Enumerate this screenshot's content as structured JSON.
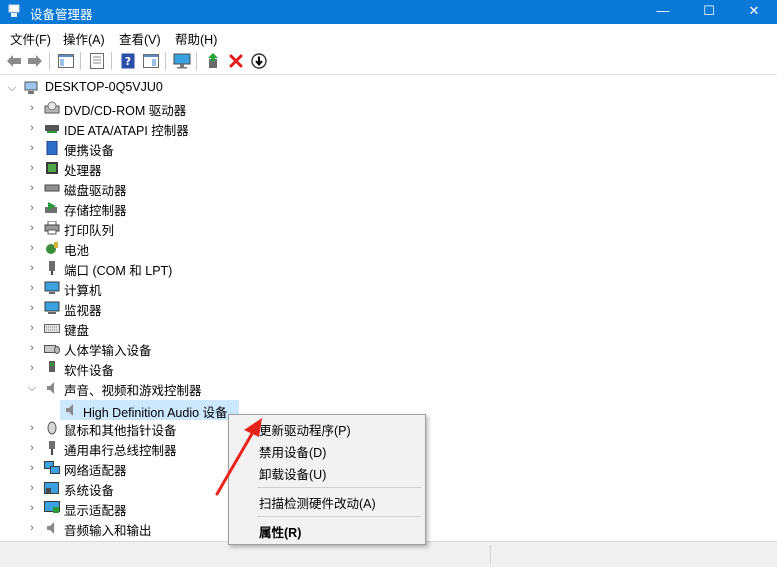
{
  "window": {
    "title": "设备管理器",
    "minimize_glyph": "—",
    "maximize_glyph": "☐",
    "close_glyph": "✕",
    "accent": "#0a78d7"
  },
  "menu": [
    "文件(F)",
    "操作(A)",
    "查看(V)",
    "帮助(H)"
  ],
  "toolbar": {
    "icons": [
      "back-arrow-icon",
      "forward-arrow-icon",
      "console-tree-icon",
      "properties-icon",
      "help-icon",
      "action-pane-icon",
      "monitor-icon",
      "update-driver-icon",
      "uninstall-icon",
      "download-icon"
    ],
    "uninstall_color": "#e01b1b"
  },
  "tree": {
    "root": "DESKTOP-0Q5VJU0",
    "categories": [
      {
        "label": "DVD/CD-ROM 驱动器",
        "expanded": false
      },
      {
        "label": "IDE ATA/ATAPI 控制器",
        "expanded": false
      },
      {
        "label": "便携设备",
        "expanded": false
      },
      {
        "label": "处理器",
        "expanded": false
      },
      {
        "label": "磁盘驱动器",
        "expanded": false
      },
      {
        "label": "存储控制器",
        "expanded": false
      },
      {
        "label": "打印队列",
        "expanded": false
      },
      {
        "label": "电池",
        "expanded": false
      },
      {
        "label": "端口 (COM 和 LPT)",
        "expanded": false
      },
      {
        "label": "计算机",
        "expanded": false
      },
      {
        "label": "监视器",
        "expanded": false
      },
      {
        "label": "键盘",
        "expanded": false
      },
      {
        "label": "人体学输入设备",
        "expanded": false
      },
      {
        "label": "软件设备",
        "expanded": false
      },
      {
        "label": "声音、视频和游戏控制器",
        "expanded": true
      },
      {
        "label": "鼠标和其他指针设备",
        "expanded": false
      },
      {
        "label": "通用串行总线控制器",
        "expanded": false
      },
      {
        "label": "网络适配器",
        "expanded": false
      },
      {
        "label": "系统设备",
        "expanded": false
      },
      {
        "label": "显示适配器",
        "expanded": false
      },
      {
        "label": "音频输入和输出",
        "expanded": false
      }
    ],
    "selected_device": "High Definition Audio 设备",
    "selection_color": "#cce8ff"
  },
  "context_menu": {
    "items": [
      "更新驱动程序(P)",
      "禁用设备(D)",
      "卸载设备(U)",
      "扫描检测硬件改动(A)",
      "属性(R)"
    ],
    "annotation_arrow_color": "#e8231c"
  }
}
